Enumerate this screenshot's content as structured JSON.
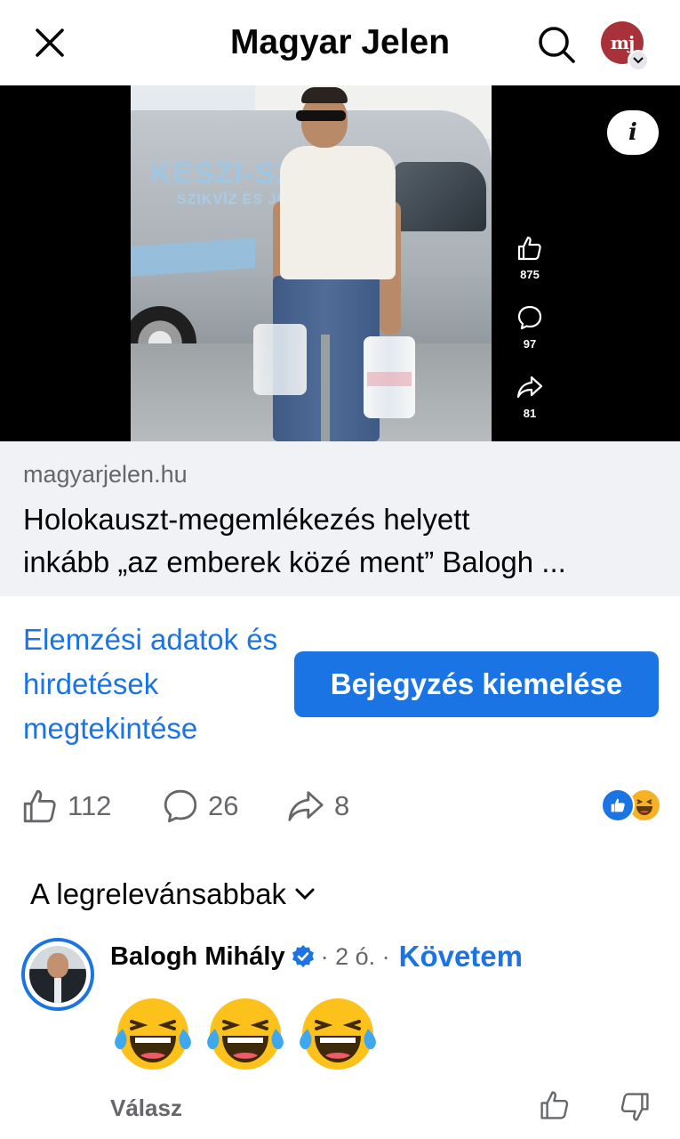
{
  "header": {
    "title": "Magyar Jelen",
    "profile_initials": "mj"
  },
  "video": {
    "van_text_1": "KESZI-SZÓ",
    "van_text_2": "SZIKVÍZ ÉS JÉG",
    "likes": "875",
    "comments": "97",
    "shares": "81",
    "info_label": "i"
  },
  "link": {
    "domain": "magyarjelen.hu",
    "title_line1": "Holokauszt-megemlékezés helyett",
    "title_line2": "inkább „az emberek közé ment” Balogh ..."
  },
  "actions": {
    "insights_label": "Elemzési adatok és hirdetések megtekintése",
    "boost_label": "Bejegyzés kiemelése"
  },
  "engagement": {
    "likes": "112",
    "comments": "26",
    "shares": "8"
  },
  "sort": {
    "label": "A legrelevánsabbak"
  },
  "comment": {
    "author": "Balogh Mihály",
    "meta": "· 2 ó. ·",
    "follow_label": "Követem",
    "reply_label": "Válasz",
    "emojis": [
      "face-with-tears-of-joy",
      "face-with-tears-of-joy",
      "face-with-tears-of-joy"
    ]
  },
  "colors": {
    "accent": "#1b74e4",
    "secondary_text": "#65676b",
    "link_card_bg": "#f0f2f5",
    "profile_avatar": "#a8323a"
  },
  "icons": [
    "close-icon",
    "search-icon",
    "chevron-down-icon",
    "info-icon",
    "like-icon",
    "comment-icon",
    "share-icon",
    "verified-icon",
    "dislike-icon"
  ]
}
